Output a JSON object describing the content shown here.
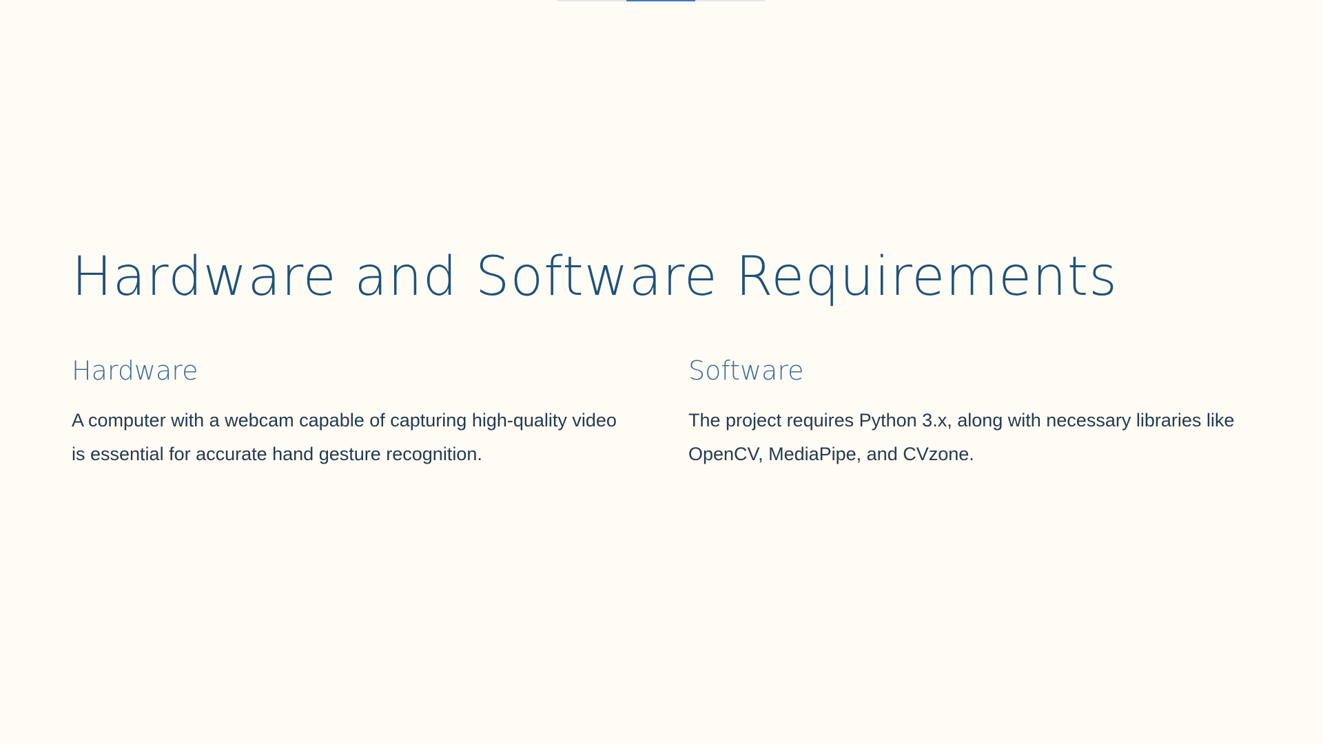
{
  "title": "Hardware and Software Requirements",
  "progress": {
    "segments": 3,
    "active_index": 1
  },
  "sections": [
    {
      "heading": "Hardware",
      "text": "A computer with a webcam capable of capturing high-quality video is essential for accurate hand gesture recognition."
    },
    {
      "heading": "Software",
      "text": "The project requires Python 3.x, along with necessary libraries like OpenCV, MediaPipe, and CVzone."
    }
  ],
  "colors": {
    "background": "#fffcf5",
    "title": "#1f5278",
    "heading": "#3c6e95",
    "body_text": "#253a4d",
    "accent": "#3a78b8"
  }
}
